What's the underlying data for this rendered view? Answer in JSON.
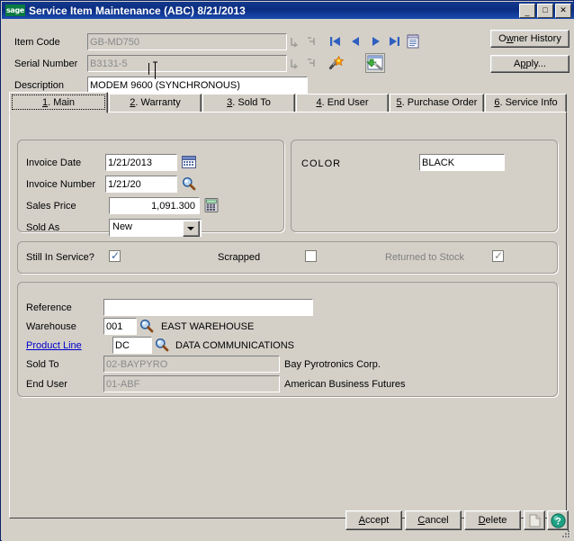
{
  "window": {
    "title": "Service Item Maintenance (ABC) 8/21/2013",
    "logo_text": "sage",
    "minimize": "_",
    "maximize": "□",
    "close": "✕"
  },
  "header": {
    "item_code_label": "Item Code",
    "item_code_value": "GB-MD750",
    "serial_number_label": "Serial Number",
    "serial_number_value": "B3131-5",
    "description_label": "Description",
    "description_value": "MODEM 9600 (SYNCHRONOUS)",
    "owner_history_button": "Owner History",
    "apply_button": "Apply...",
    "icons": {
      "expand_1": "expand-bracket-icon",
      "collapse_1": "collapse-bracket-icon",
      "expand_2": "expand-bracket-icon",
      "collapse_2": "collapse-bracket-icon",
      "first": "first-record-icon",
      "prev": "previous-record-icon",
      "next": "next-record-icon",
      "last": "last-record-icon",
      "list": "list-lookup-icon",
      "wand": "magic-wand-icon",
      "quick_print": "quick-print-icon"
    }
  },
  "tabs": [
    {
      "num": "1",
      "label": ". Main",
      "active": true
    },
    {
      "num": "2",
      "label": ". Warranty",
      "active": false
    },
    {
      "num": "3",
      "label": ". Sold To",
      "active": false
    },
    {
      "num": "4",
      "label": ". End User",
      "active": false
    },
    {
      "num": "5",
      "label": ". Purchase Order",
      "active": false
    },
    {
      "num": "6",
      "label": ". Service Info",
      "active": false
    }
  ],
  "main_tab": {
    "invoice_group": {
      "invoice_date_label": "Invoice Date",
      "invoice_date_value": "1/21/2013",
      "calendar_icon": "calendar-icon",
      "invoice_number_label": "Invoice Number",
      "invoice_number_value": "1/21/20",
      "invoice_number_lookup_icon": "magnifier-lookup-icon",
      "sales_price_label": "Sales Price",
      "sales_price_value": "1,091.300",
      "calculator_icon": "calculator-icon",
      "sold_as_label": "Sold As",
      "sold_as_value": "New",
      "sold_as_options": [
        "New"
      ]
    },
    "color_group": {
      "color_label": "COLOR",
      "color_value": "BLACK"
    },
    "status_row": {
      "still_in_service_label": "Still In Service?",
      "still_in_service_checked": true,
      "scrapped_label": "Scrapped",
      "scrapped_checked": false,
      "returned_to_stock_label": "Returned to Stock",
      "returned_to_stock_checked": true,
      "returned_to_stock_disabled": true
    },
    "detail_group": {
      "reference_label": "Reference",
      "reference_value": "",
      "warehouse_label": "Warehouse",
      "warehouse_value": "001",
      "warehouse_lookup_icon": "magnifier-lookup-icon",
      "warehouse_description": "EAST WAREHOUSE",
      "product_line_label": "Product Line",
      "product_line_value": "DC",
      "product_line_lookup_icon": "magnifier-lookup-icon",
      "product_line_description": "DATA COMMUNICATIONS",
      "sold_to_label": "Sold To",
      "sold_to_value": "02-BAYPYRO",
      "sold_to_description": "Bay Pyrotronics Corp.",
      "end_user_label": "End User",
      "end_user_value": "01-ABF",
      "end_user_description": "American Business Futures"
    }
  },
  "footer": {
    "accept_prefix": "A",
    "accept_rest": "ccept",
    "cancel_prefix": "C",
    "cancel_rest": "ancel",
    "delete_prefix": "D",
    "delete_rest": "elete",
    "print_icon": "print-preview-icon",
    "help_icon": "help-question-icon"
  },
  "colors": {
    "titlebar": "#0a2d81",
    "face": "#d4d0c8",
    "link": "#0000cc",
    "check": "#39699e",
    "sage_green": "#0a7a43",
    "help_green": "#159c78"
  }
}
